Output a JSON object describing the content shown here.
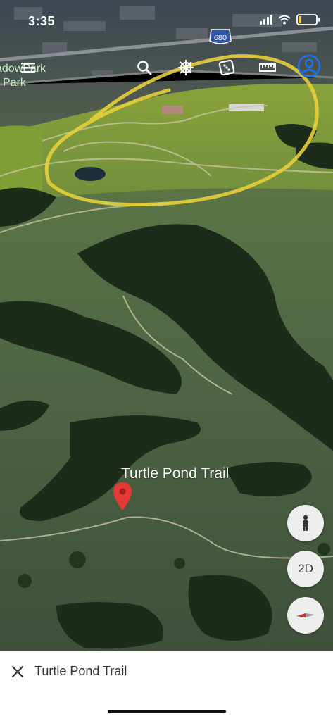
{
  "status_bar": {
    "time": "3:35"
  },
  "map": {
    "place_label": "adowPark\nPark",
    "highway_shield": "680",
    "marker_title": "Turtle Pond Trail",
    "annotation_color": "#e8cf3a"
  },
  "toolbar": {
    "icons": [
      "menu-icon",
      "search-icon",
      "voyager-wheel-icon",
      "feeling-lucky-dice-icon",
      "measure-ruler-icon",
      "account-icon"
    ]
  },
  "controls": {
    "pegman": "pegman-icon",
    "toggle_2d_label": "2D",
    "compass": "compass-icon"
  },
  "sheet": {
    "title": "Turtle Pond Trail"
  },
  "colors": {
    "account_blue": "#1a73e8",
    "pin_red": "#e53935",
    "compass_red": "#d32f2f"
  }
}
